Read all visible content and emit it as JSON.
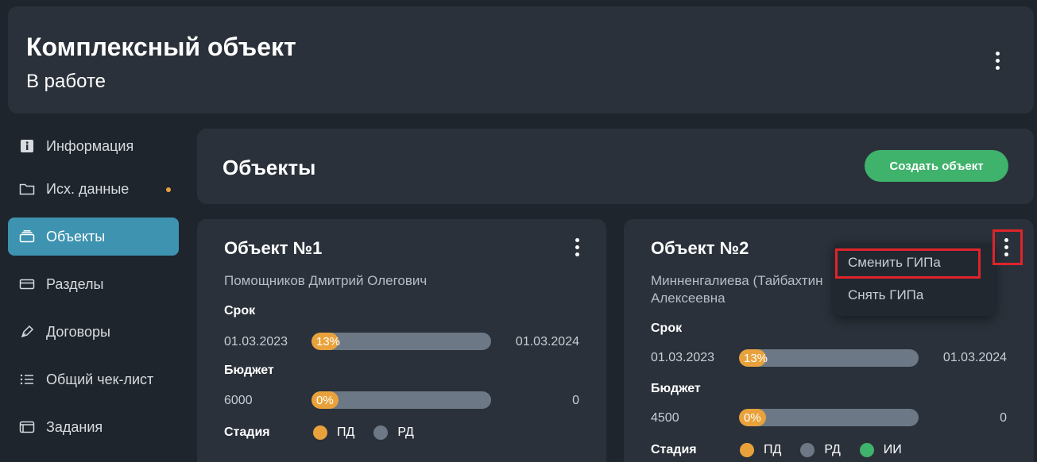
{
  "header": {
    "title": "Комплексный объект",
    "status": "В работе"
  },
  "sidebar": {
    "items": [
      {
        "label": "Информация",
        "icon": "info-icon",
        "active": false
      },
      {
        "label": "Исх. данные",
        "icon": "folder-icon",
        "active": false,
        "has_dot": true
      },
      {
        "label": "Объекты",
        "icon": "stack-icon",
        "active": true
      },
      {
        "label": "Разделы",
        "icon": "sections-icon",
        "active": false
      },
      {
        "label": "Договоры",
        "icon": "pen-icon",
        "active": false
      },
      {
        "label": "Общий чек-лист",
        "icon": "list-icon",
        "active": false
      },
      {
        "label": "Задания",
        "icon": "tasks-icon",
        "active": false
      }
    ]
  },
  "objects_panel": {
    "title": "Объекты",
    "create_button": "Создать объект"
  },
  "cards": [
    {
      "title": "Объект №1",
      "owner": "Помощников Дмитрий Олегович",
      "term_label": "Срок",
      "term_start": "01.03.2023",
      "term_end": "01.03.2024",
      "term_progress_label": "13%",
      "term_progress": 0.13,
      "budget_label": "Бюджет",
      "budget_value": "6000",
      "budget_end": "0",
      "budget_progress_label": "0%",
      "budget_progress": 0,
      "stage_label": "Стадия",
      "stages": [
        {
          "name": "ПД",
          "color": "#e9a23b"
        },
        {
          "name": "РД",
          "color": "#6c7885"
        }
      ]
    },
    {
      "title": "Объект №2",
      "owner_line1": "Минненгалиева (Тайбахтин",
      "owner_line2": "Алексеевна",
      "term_label": "Срок",
      "term_start": "01.03.2023",
      "term_end": "01.03.2024",
      "term_progress_label": "13%",
      "term_progress": 0.13,
      "budget_label": "Бюджет",
      "budget_value": "4500",
      "budget_end": "0",
      "budget_progress_label": "0%",
      "budget_progress": 0,
      "stage_label": "Стадия",
      "stages": [
        {
          "name": "ПД",
          "color": "#e9a23b"
        },
        {
          "name": "РД",
          "color": "#6c7885"
        },
        {
          "name": "ИИ",
          "color": "#3fb26b"
        }
      ]
    }
  ],
  "dropdown": {
    "items": [
      "Сменить ГИПа",
      "Снять ГИПа"
    ]
  },
  "colors": {
    "background": "#1e252c",
    "panel": "#2a313a",
    "accent_active": "#3d93b0",
    "create_button": "#3fb26b",
    "progress": "#e9a23b",
    "highlight": "#e0242a"
  }
}
